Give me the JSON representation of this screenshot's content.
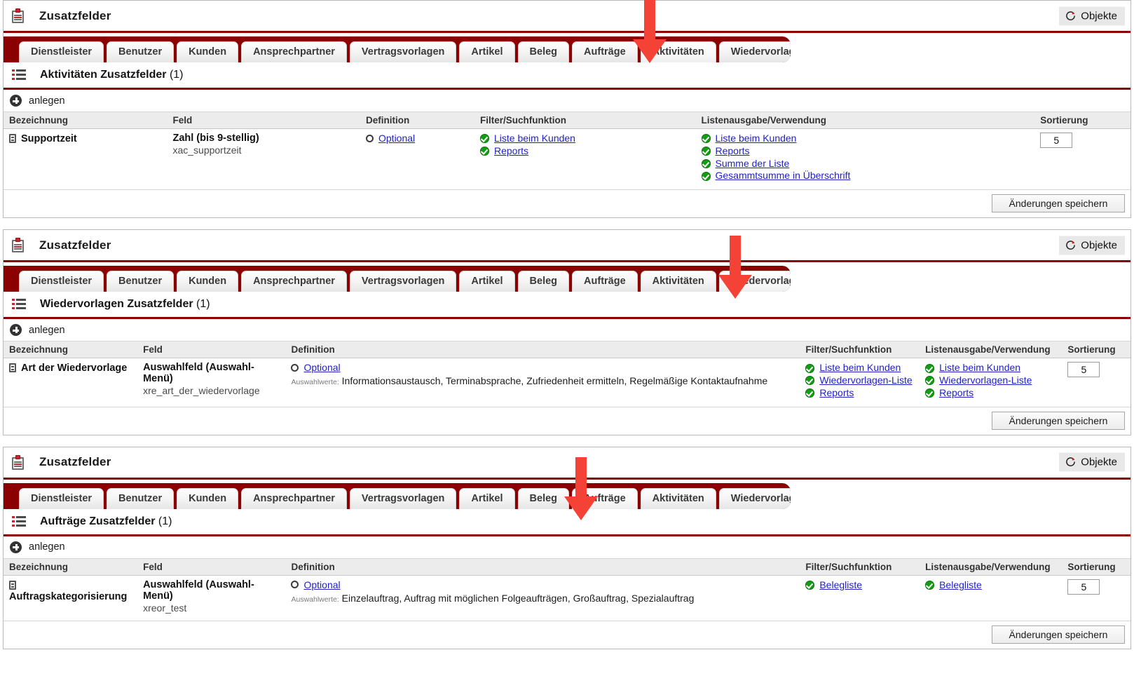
{
  "panel_title": "Zusatzfelder",
  "objekte_button": "Objekte",
  "tabs": [
    "Dienstleister",
    "Benutzer",
    "Kunden",
    "Ansprechpartner",
    "Vertragsvorlagen",
    "Artikel",
    "Beleg",
    "Aufträge",
    "Aktivitäten",
    "Wiedervorlagen"
  ],
  "anlegen_label": "anlegen",
  "save_label": "Änderungen speichern",
  "colors": {
    "brand_red": "#8b0000",
    "arrow_red": "#f44336",
    "link_blue": "#2121c7",
    "check_green": "#169b16"
  },
  "sections": [
    {
      "id": "aktivitaeten",
      "active_tab": "Aktivitäten",
      "section_title_bold": "Aktivitäten Zusatzfelder",
      "section_title_count": "(1)",
      "headers": {
        "bezeichnung": "Bezeichnung",
        "feld": "Feld",
        "definition": "Definition",
        "filter": "Filter/Suchfunktion",
        "listenausgabe": "Listenausgabe/Verwendung",
        "sortierung": "Sortierung"
      },
      "row": {
        "bezeichnung": "Supportzeit",
        "feld_type": "Zahl (bis 9-stellig)",
        "feld_name": "xac_supportzeit",
        "definition": "Optional",
        "auswahlwerte_label": "",
        "auswahlwerte": "",
        "filter": [
          "Liste beim Kunden",
          "Reports"
        ],
        "listenausgabe": [
          "Liste beim Kunden",
          "Reports",
          "Summe der Liste",
          "Gesammtsumme in Überschrift"
        ],
        "sortierung": "5"
      }
    },
    {
      "id": "wiedervorlagen",
      "active_tab": "Wiedervorlagen",
      "section_title_bold": "Wiedervorlagen Zusatzfelder",
      "section_title_count": "(1)",
      "headers": {
        "bezeichnung": "Bezeichnung",
        "feld": "Feld",
        "definition": "Definition",
        "filter": "Filter/Suchfunktion",
        "listenausgabe": "Listenausgabe/Verwendung",
        "sortierung": "Sortierung"
      },
      "row": {
        "bezeichnung": "Art der Wiedervorlage",
        "feld_type": "Auswahlfeld (Auswahl-Menü)",
        "feld_name": "xre_art_der_wiedervorlage",
        "definition": "Optional",
        "auswahlwerte_label": "Auswahlwerte:",
        "auswahlwerte": "Informationsaustausch, Terminabsprache, Zufriedenheit ermitteln, Regelmäßige Kontaktaufnahme",
        "filter": [
          "Liste beim Kunden",
          "Wiedervorlagen-Liste",
          "Reports"
        ],
        "listenausgabe": [
          "Liste beim Kunden",
          "Wiedervorlagen-Liste",
          "Reports"
        ],
        "sortierung": "5"
      }
    },
    {
      "id": "auftraege",
      "active_tab": "Aufträge",
      "section_title_bold": "Aufträge Zusatzfelder",
      "section_title_count": "(1)",
      "headers": {
        "bezeichnung": "Bezeichnung",
        "feld": "Feld",
        "definition": "Definition",
        "filter": "Filter/Suchfunktion",
        "listenausgabe": "Listenausgabe/Verwendung",
        "sortierung": "Sortierung"
      },
      "row": {
        "bezeichnung": "Auftragskategorisierung",
        "feld_type": "Auswahlfeld (Auswahl-Menü)",
        "feld_name": "xreor_test",
        "definition": "Optional",
        "auswahlwerte_label": "Auswahlwerte:",
        "auswahlwerte": "Einzelauftrag, Auftrag mit möglichen Folgeaufträgen, Großauftrag, Spezialauftrag",
        "filter": [
          "Belegliste"
        ],
        "listenausgabe": [
          "Belegliste"
        ],
        "sortierung": "5"
      }
    }
  ]
}
